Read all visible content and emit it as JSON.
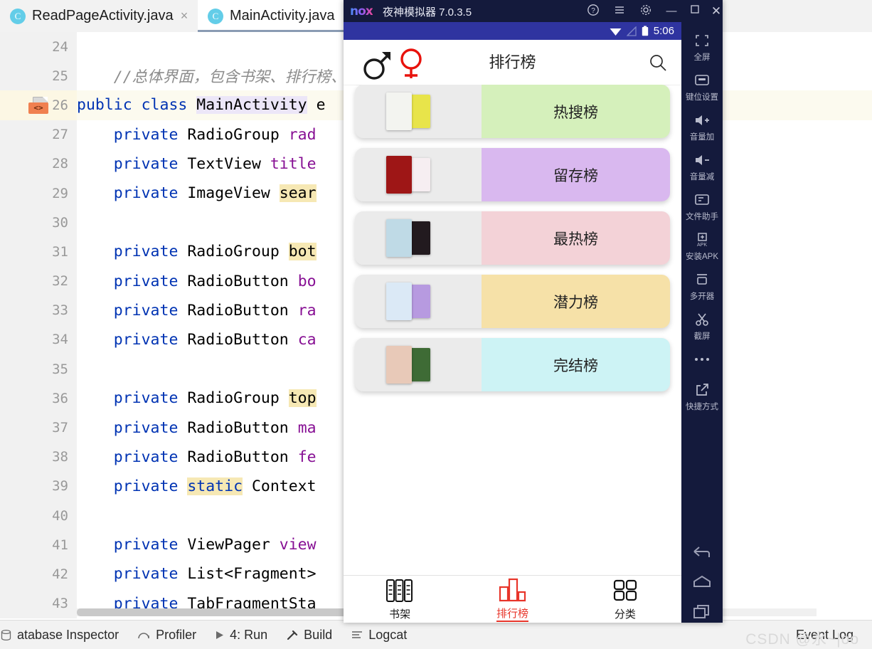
{
  "ide": {
    "tabs": [
      {
        "label": "ReadPageActivity.java",
        "icon": "java-class-icon",
        "active": false,
        "closable": true
      },
      {
        "label": "MainActivity.java",
        "icon": "java-class-icon",
        "active": true,
        "closable": false
      }
    ],
    "code_lines": [
      {
        "number": "24",
        "segments": []
      },
      {
        "number": "25",
        "segments": [
          {
            "t": "    //总体界面，包含书架、排行榜、分类",
            "c": "cmt"
          }
        ]
      },
      {
        "number": "26",
        "highlight": true,
        "gutter_icon": "layout-xml-icon",
        "segments": [
          {
            "t": "public class ",
            "c": "kw"
          },
          {
            "t": "MainActivity",
            "c": "hl-ident"
          },
          {
            "t": " e",
            "c": "ty"
          }
        ]
      },
      {
        "number": "27",
        "segments": [
          {
            "t": "    private ",
            "c": "kw"
          },
          {
            "t": "RadioGroup ",
            "c": "ty"
          },
          {
            "t": "rad",
            "c": "fld"
          }
        ]
      },
      {
        "number": "28",
        "segments": [
          {
            "t": "    private ",
            "c": "kw"
          },
          {
            "t": "TextView ",
            "c": "ty"
          },
          {
            "t": "title",
            "c": "fld"
          }
        ]
      },
      {
        "number": "29",
        "segments": [
          {
            "t": "    private ",
            "c": "kw"
          },
          {
            "t": "ImageView ",
            "c": "ty"
          },
          {
            "t": "sear",
            "c": "hl-occ"
          }
        ]
      },
      {
        "number": "30",
        "segments": []
      },
      {
        "number": "31",
        "segments": [
          {
            "t": "    private ",
            "c": "kw"
          },
          {
            "t": "RadioGroup ",
            "c": "ty"
          },
          {
            "t": "bot",
            "c": "hl-occ"
          }
        ]
      },
      {
        "number": "32",
        "segments": [
          {
            "t": "    private ",
            "c": "kw"
          },
          {
            "t": "RadioButton ",
            "c": "ty"
          },
          {
            "t": "bo",
            "c": "fld"
          }
        ]
      },
      {
        "number": "33",
        "segments": [
          {
            "t": "    private ",
            "c": "kw"
          },
          {
            "t": "RadioButton ",
            "c": "ty"
          },
          {
            "t": "ra",
            "c": "fld"
          }
        ]
      },
      {
        "number": "34",
        "segments": [
          {
            "t": "    private ",
            "c": "kw"
          },
          {
            "t": "RadioButton ",
            "c": "ty"
          },
          {
            "t": "ca",
            "c": "fld"
          }
        ]
      },
      {
        "number": "35",
        "segments": []
      },
      {
        "number": "36",
        "segments": [
          {
            "t": "    private ",
            "c": "kw"
          },
          {
            "t": "RadioGroup ",
            "c": "ty"
          },
          {
            "t": "top",
            "c": "hl-occ"
          }
        ]
      },
      {
        "number": "37",
        "segments": [
          {
            "t": "    private ",
            "c": "kw"
          },
          {
            "t": "RadioButton ",
            "c": "ty"
          },
          {
            "t": "ma",
            "c": "fld"
          }
        ]
      },
      {
        "number": "38",
        "segments": [
          {
            "t": "    private ",
            "c": "kw"
          },
          {
            "t": "RadioButton ",
            "c": "ty"
          },
          {
            "t": "fe",
            "c": "fld"
          }
        ]
      },
      {
        "number": "39",
        "segments": [
          {
            "t": "    private ",
            "c": "kw"
          },
          {
            "t": "static",
            "c": "hl-occ kw"
          },
          {
            "t": " Context",
            "c": "ty"
          }
        ]
      },
      {
        "number": "40",
        "segments": []
      },
      {
        "number": "41",
        "segments": [
          {
            "t": "    private ",
            "c": "kw"
          },
          {
            "t": "ViewPager ",
            "c": "ty"
          },
          {
            "t": "view",
            "c": "fld"
          }
        ]
      },
      {
        "number": "42",
        "segments": [
          {
            "t": "    private ",
            "c": "kw"
          },
          {
            "t": "List<Fragment>",
            "c": "ty"
          }
        ]
      },
      {
        "number": "43",
        "segments": [
          {
            "t": "    private ",
            "c": "kw"
          },
          {
            "t": "TabFragmentSta",
            "c": "ty"
          }
        ]
      }
    ],
    "status_bar": {
      "left_items": [
        {
          "label": "atabase Inspector",
          "icon": "database-icon"
        },
        {
          "label": "Profiler",
          "icon": "profiler-icon"
        },
        {
          "label": "4: Run",
          "icon": "run-icon"
        },
        {
          "label": "Build",
          "icon": "build-hammer-icon"
        },
        {
          "label": "Logcat",
          "icon": "logcat-icon"
        }
      ],
      "right_items": [
        {
          "label": "Event Log",
          "icon": "event-log-icon"
        }
      ]
    },
    "watermark": "CSDN @氷~|oo"
  },
  "nox": {
    "logo": "nox",
    "title": "夜神模拟器 7.0.3.5",
    "window_buttons": [
      {
        "name": "help-icon",
        "glyph": "?"
      },
      {
        "name": "menu-icon",
        "glyph": "☰"
      },
      {
        "name": "settings-gear-icon",
        "glyph": "⚙"
      },
      {
        "name": "minimize-icon",
        "glyph": "—"
      },
      {
        "name": "maximize-icon",
        "glyph": "□"
      },
      {
        "name": "close-icon",
        "glyph": "✕"
      },
      {
        "name": "collapse-sidebar-icon",
        "glyph": "«"
      }
    ],
    "toolbar": [
      {
        "label": "全屏",
        "icon": "fullscreen-icon"
      },
      {
        "label": "键位设置",
        "icon": "keymapping-icon"
      },
      {
        "label": "音量加",
        "icon": "volume-up-icon"
      },
      {
        "label": "音量减",
        "icon": "volume-down-icon"
      },
      {
        "label": "文件助手",
        "icon": "file-assistant-icon"
      },
      {
        "label": "安装APK",
        "icon": "install-apk-icon"
      },
      {
        "label": "多开器",
        "icon": "multi-instance-icon"
      },
      {
        "label": "截屏",
        "icon": "screenshot-scissors-icon"
      },
      {
        "label": "",
        "icon": "more-dots-icon"
      },
      {
        "label": "快捷方式",
        "icon": "shortcut-icon"
      }
    ],
    "nav_buttons": [
      {
        "name": "android-back-icon"
      },
      {
        "name": "android-home-icon"
      },
      {
        "name": "android-recents-icon"
      }
    ]
  },
  "android": {
    "status_bar": {
      "time": "5:06",
      "icons": [
        "wifi-icon",
        "signal-icon",
        "battery-icon"
      ]
    },
    "app_header": {
      "title": "排行榜",
      "male_icon": "male-gender-icon",
      "female_icon": "female-gender-icon",
      "male_color": "#1a1a1a",
      "female_color": "#e8120c",
      "search_icon": "search-icon"
    },
    "rank_cards": [
      {
        "label": "热搜榜",
        "color": "#d5f0bb",
        "thumb_a": "#f3f4f0",
        "thumb_b": "#e8e44a"
      },
      {
        "label": "留存榜",
        "color": "#d9b8ef",
        "thumb_a": "#9e1616",
        "thumb_b": "#f6eef1"
      },
      {
        "label": "最热榜",
        "color": "#f3d2d7",
        "thumb_a": "#bfdae6",
        "thumb_b": "#221a1f"
      },
      {
        "label": "潜力榜",
        "color": "#f6e1a8",
        "thumb_a": "#dbe9f6",
        "thumb_b": "#b79ae0"
      },
      {
        "label": "完结榜",
        "color": "#cdf3f5",
        "thumb_a": "#e8c9b8",
        "thumb_b": "#3e6b35"
      }
    ],
    "bottom_nav": [
      {
        "label": "书架",
        "icon": "bookshelf-icon",
        "active": false
      },
      {
        "label": "排行榜",
        "icon": "ranking-bars-icon",
        "active": true
      },
      {
        "label": "分类",
        "icon": "category-grid-icon",
        "active": false
      }
    ],
    "accent_color": "#e8352a"
  }
}
